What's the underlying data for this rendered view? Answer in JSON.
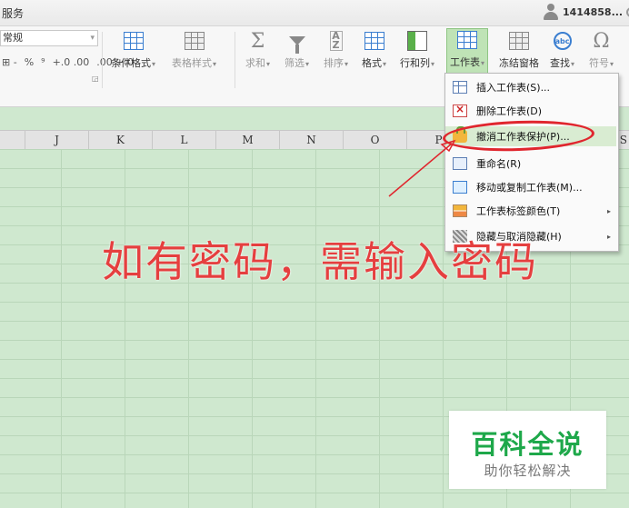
{
  "titlebar": {
    "menu_text": "服务",
    "user_id": "1414858..."
  },
  "ribbon": {
    "number_format": "常规",
    "number_controls": [
      "⊞ -",
      "%",
      "⁹",
      "+.0 .00",
      ".00 +.0"
    ],
    "buttons": [
      {
        "label": "条件格式",
        "caret": "▾",
        "enabled": true
      },
      {
        "label": "表格样式",
        "caret": "▾",
        "enabled": false
      },
      {
        "label": "求和",
        "caret": "▾",
        "enabled": false
      },
      {
        "label": "筛选",
        "caret": "▾",
        "enabled": false
      },
      {
        "label": "排序",
        "caret": "▾",
        "enabled": false
      },
      {
        "label": "格式",
        "caret": "▾",
        "enabled": true
      },
      {
        "label": "行和列",
        "caret": "▾",
        "enabled": true
      },
      {
        "label": "工作表",
        "caret": "▾",
        "enabled": true
      },
      {
        "label": "冻结窗格",
        "caret": "",
        "enabled": true
      },
      {
        "label": "查找",
        "caret": "▾",
        "enabled": true
      },
      {
        "label": "符号",
        "caret": "▾",
        "enabled": false
      }
    ],
    "icons": {
      "sum": "Σ",
      "sort": "A Z",
      "find": "abc",
      "symbol": "Ω"
    }
  },
  "columns": [
    "J",
    "K",
    "L",
    "M",
    "N",
    "O",
    "P",
    "S"
  ],
  "sheet_menu": {
    "items": [
      {
        "label": "插入工作表(S)...",
        "icon": "insert-sheet-icon",
        "submenu": false,
        "highlighted": false
      },
      {
        "label": "删除工作表(D)",
        "icon": "delete-sheet-icon",
        "submenu": false,
        "highlighted": false
      },
      {
        "label": "撤消工作表保护(P)...",
        "icon": "unprotect-sheet-icon",
        "submenu": false,
        "highlighted": true
      },
      {
        "label": "重命名(R)",
        "icon": "rename-icon",
        "submenu": false,
        "highlighted": false
      },
      {
        "label": "移动或复制工作表(M)...",
        "icon": "move-copy-icon",
        "submenu": false,
        "highlighted": false
      },
      {
        "label": "工作表标签颜色(T)",
        "icon": "tab-color-icon",
        "submenu": true,
        "highlighted": false
      },
      {
        "label": "隐藏与取消隐藏(H)",
        "icon": "hide-icon",
        "submenu": true,
        "highlighted": false
      }
    ],
    "submenu_arrow": "▸"
  },
  "annotation": {
    "text": "如有密码，需输入密码",
    "color": "#e53f3f"
  },
  "watermark": {
    "title": "百科全说",
    "subtitle": "助你轻松解决",
    "title_color": "#1ea84a"
  },
  "colors": {
    "sheet_bg": "#cfe8cf",
    "active_tab": "#bfe3b6",
    "highlight_ring": "#e0262e"
  }
}
